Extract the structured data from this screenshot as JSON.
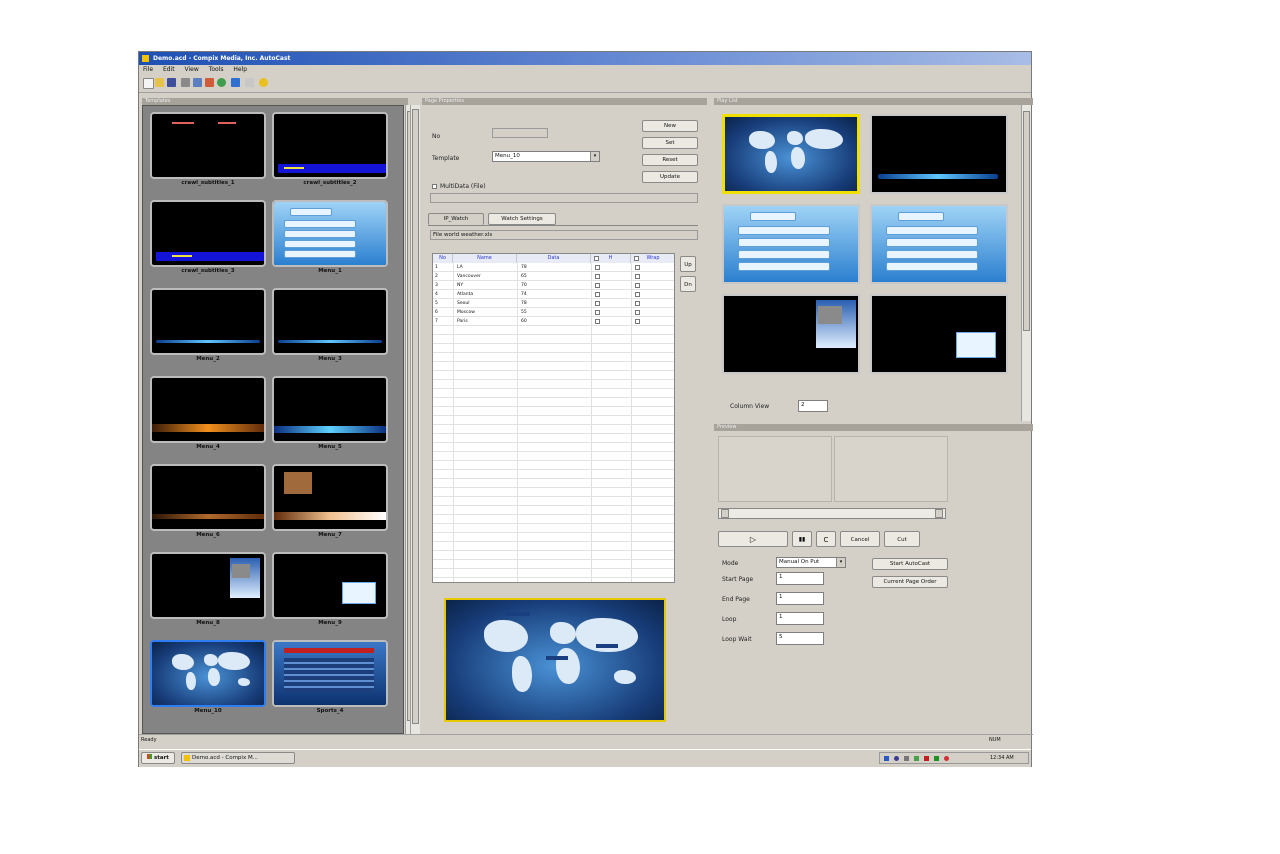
{
  "window": {
    "title": "Demo.acd - Compix Media, Inc. AutoCast"
  },
  "menu": [
    "File",
    "Edit",
    "View",
    "Tools",
    "Help"
  ],
  "left_panel": {
    "header": "Templates",
    "thumbnails": [
      {
        "label": "crawl_subtitles_1"
      },
      {
        "label": "crawl_subtitles_2"
      },
      {
        "label": "crawl_subtitles_3"
      },
      {
        "label": "Menu_1"
      },
      {
        "label": "Menu_2"
      },
      {
        "label": "Menu_3"
      },
      {
        "label": "Menu_4"
      },
      {
        "label": "Menu_5"
      },
      {
        "label": "Menu_6"
      },
      {
        "label": "Menu_7"
      },
      {
        "label": "Menu_8"
      },
      {
        "label": "Menu_9"
      },
      {
        "label": "Menu_10"
      },
      {
        "label": "Sports_4"
      }
    ]
  },
  "mid_panel": {
    "header": "Page Properties",
    "no_label": "No",
    "template_label": "Template",
    "template_value": "Menu_10",
    "buttons": [
      "New",
      "Set",
      "Reset",
      "Update"
    ],
    "multidata_label": "MultiData (File)",
    "tabs": [
      "IP_Watch",
      "Watch Settings"
    ],
    "file_label": "File",
    "file_value": "world weather.xls",
    "table": {
      "columns": [
        "No",
        "Name",
        "Data",
        "H",
        "Wrap"
      ],
      "rows": [
        [
          "1",
          "LA",
          "78"
        ],
        [
          "2",
          "Vancouver",
          "65"
        ],
        [
          "3",
          "NY",
          "70"
        ],
        [
          "4",
          "Atlanta",
          "74"
        ],
        [
          "5",
          "Seoul",
          "78"
        ],
        [
          "6",
          "Moscow",
          "55"
        ],
        [
          "7",
          "Paris",
          "60"
        ]
      ]
    },
    "side_buttons": [
      "Up",
      "Dn"
    ]
  },
  "right_panel": {
    "header": "Play List",
    "column_view_label": "Column View",
    "column_view_value": "2",
    "player_header": "Preview",
    "controls": {
      "play": "▷",
      "pause": "▮▮",
      "loop": "C",
      "cancel_label": "Cancel",
      "cut_label": "Cut"
    },
    "mode_label": "Mode",
    "mode_value": "Manual On Put",
    "start_page_label": "Start Page",
    "start_page_value": "1",
    "end_page_label": "End Page",
    "end_page_value": "1",
    "loop_label": "Loop",
    "loop_value": "1",
    "loop_wait_label": "Loop Wait",
    "loop_wait_value": "5",
    "start_autocast_label": "Start AutoCast",
    "current_page_order_label": "Current Page Order"
  },
  "status": {
    "text": "Ready",
    "right": "NUM"
  },
  "taskbar": {
    "start_label": "start",
    "task_label": "Demo.acd - Compix M...",
    "clock": "12:34 AM"
  }
}
